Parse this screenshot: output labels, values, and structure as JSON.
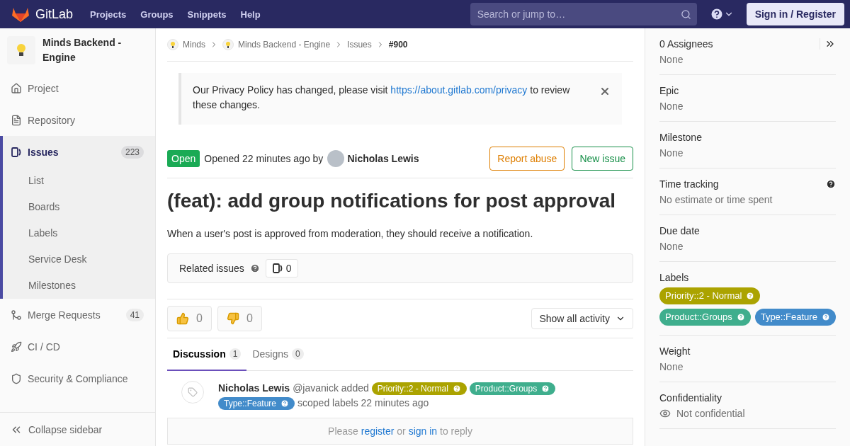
{
  "header": {
    "brand": "GitLab",
    "nav": [
      "Projects",
      "Groups",
      "Snippets",
      "Help"
    ],
    "search": {
      "placeholder": "Search or jump to…"
    },
    "sign_in": "Sign in / Register"
  },
  "sidebar": {
    "project_name": "Minds Backend - Engine",
    "items": [
      {
        "label": "Project",
        "selected": false
      },
      {
        "label": "Repository",
        "selected": false
      },
      {
        "label": "Issues",
        "count": "223",
        "selected": true,
        "children": [
          {
            "label": "List"
          },
          {
            "label": "Boards"
          },
          {
            "label": "Labels"
          },
          {
            "label": "Service Desk"
          },
          {
            "label": "Milestones"
          }
        ]
      },
      {
        "label": "Merge Requests",
        "count": "41",
        "selected": false
      },
      {
        "label": "CI / CD",
        "selected": false
      },
      {
        "label": "Security & Compliance",
        "selected": false
      }
    ],
    "collapse": "Collapse sidebar"
  },
  "breadcrumbs": [
    "Minds",
    "Minds Backend - Engine",
    "Issues",
    "#900"
  ],
  "alert": {
    "before": "Our Privacy Policy has changed, please visit ",
    "link": "https://about.gitlab.com/privacy",
    "after": " to review these changes."
  },
  "issue": {
    "status": "Open",
    "opened": "Opened 22 minutes ago by",
    "author": "Nicholas Lewis",
    "actions": [
      {
        "label": "Report abuse",
        "kind": "warning"
      },
      {
        "label": "New issue",
        "kind": "success"
      }
    ],
    "title": "(feat): add group notifications for post approval",
    "description": "When a user's post is approved from moderation, they should receive a notification."
  },
  "related": {
    "label": "Related issues",
    "count": "0"
  },
  "reactions": [
    {
      "kind": "up",
      "count": "0"
    },
    {
      "kind": "down",
      "count": "0"
    }
  ],
  "activity_filter": "Show all activity",
  "tabs": [
    {
      "label": "Discussion",
      "count": "1",
      "selected": true
    },
    {
      "label": "Designs",
      "count": "0",
      "selected": false
    }
  ],
  "note": {
    "author": "Nicholas Lewis",
    "handle": "@javanick added",
    "labels": [
      {
        "text": "Priority::2 - Normal",
        "color": "#aba300"
      },
      {
        "text": "Product::Groups",
        "color": "#3fae8d"
      },
      {
        "text": "Type::Feature",
        "color": "#428bca"
      }
    ],
    "suffix": "scoped labels 22 minutes ago"
  },
  "reply": {
    "before": "Please",
    "register": "register",
    "middle": "or",
    "sign_in": "sign in",
    "after": "to reply"
  },
  "right_sidebar": [
    {
      "title": "0 Assignees",
      "value": "None",
      "kind": "collapsible"
    },
    {
      "title": "Epic",
      "value": "None",
      "kind": "plain"
    },
    {
      "title": "Milestone",
      "value": "None",
      "kind": "plain"
    },
    {
      "title": "Time tracking",
      "value": "No estimate or time spent",
      "kind": "help"
    },
    {
      "title": "Due date",
      "value": "None",
      "kind": "plain"
    },
    {
      "title": "Labels",
      "kind": "labels",
      "labels": [
        {
          "text": "Priority::2 - Normal",
          "color": "#aba300"
        },
        {
          "text": "Product::Groups",
          "color": "#3fae8d"
        },
        {
          "text": "Type::Feature",
          "color": "#428bca"
        }
      ]
    },
    {
      "title": "Weight",
      "value": "None",
      "kind": "plain"
    },
    {
      "title": "Confidentiality",
      "value": "Not confidential",
      "kind": "confidential"
    }
  ]
}
